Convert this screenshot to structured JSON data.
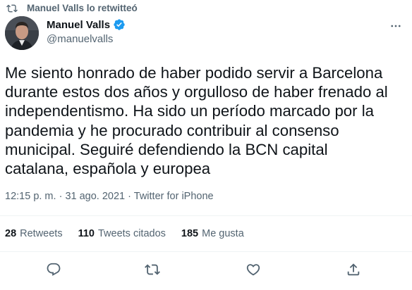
{
  "retweet_header": {
    "text": "Manuel Valls lo retwitteó"
  },
  "author": {
    "name": "Manuel Valls",
    "handle": "@manuelvalls"
  },
  "tweet": {
    "lines": [
      "Me siento honrado de haber podido servir a Barcelona",
      "durante estos dos años y orgulloso de haber frenado al",
      "independentismo. Ha sido un período marcado por la",
      "pandemia y he procurado contribuir al consenso",
      "municipal. Seguiré defendiendo la BCN capital",
      "catalana, española y europea"
    ]
  },
  "meta": {
    "time": "12:15 p. m.",
    "separator": "·",
    "date": "31 ago. 2021",
    "source": "Twitter for iPhone"
  },
  "stats": {
    "retweets": {
      "count": "28",
      "label": "Retweets"
    },
    "quotes": {
      "count": "110",
      "label": "Tweets citados"
    },
    "likes": {
      "count": "185",
      "label": "Me gusta"
    }
  },
  "icons": {
    "retweet": "retweet-icon",
    "verified": "verified-badge-icon",
    "more": "more-options-icon",
    "reply": "reply-icon",
    "like": "heart-icon",
    "share": "share-icon"
  },
  "colors": {
    "verified": "#1d9bf0",
    "muted": "#536471",
    "text": "#0f1419",
    "divider": "#eff3f4"
  }
}
